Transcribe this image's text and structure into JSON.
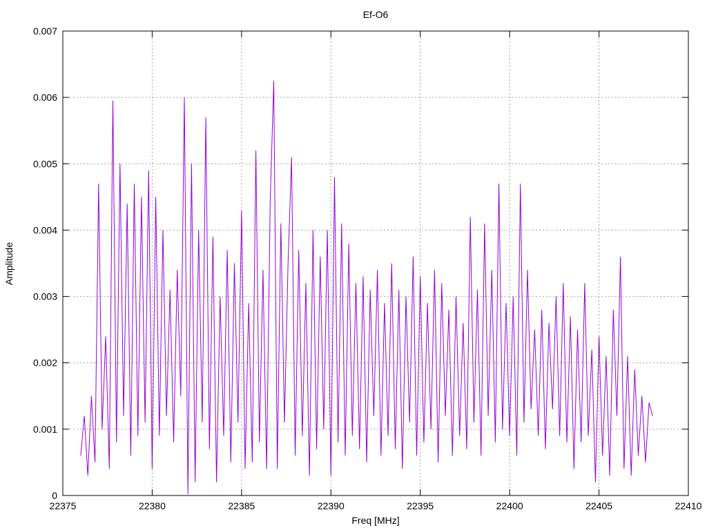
{
  "chart_data": {
    "type": "line",
    "title": "Ef-O6",
    "xlabel": "Freq [MHz]",
    "ylabel": "Amplitude",
    "xlim": [
      22375,
      22410
    ],
    "ylim": [
      0,
      0.007
    ],
    "xticks": [
      "22375",
      "22380",
      "22385",
      "22390",
      "22395",
      "22400",
      "22405",
      "22410"
    ],
    "xtick_values": [
      22375,
      22380,
      22385,
      22390,
      22395,
      22400,
      22405,
      22410
    ],
    "yticks": [
      "0",
      "0.001",
      "0.002",
      "0.003",
      "0.004",
      "0.005",
      "0.006",
      "0.007"
    ],
    "ytick_values": [
      0,
      0.001,
      0.002,
      0.003,
      0.004,
      0.005,
      0.006,
      0.007
    ],
    "grid": true,
    "legend": "none",
    "series": [
      {
        "name": "Ef-O6",
        "color": "#9400d3",
        "x_start": 22376.0,
        "x_step": 0.2,
        "values": [
          0.0006,
          0.0012,
          0.0003,
          0.0015,
          0.0005,
          0.0047,
          0.001,
          0.0024,
          0.0004,
          0.00595,
          0.0008,
          0.005,
          0.0012,
          0.0044,
          0.0006,
          0.0047,
          0.0009,
          0.0045,
          0.0011,
          0.0049,
          0.0004,
          0.0045,
          0.0009,
          0.004,
          0.0012,
          0.0031,
          0.0008,
          0.0034,
          0.0015,
          0.006,
          2e-05,
          0.005,
          0.0002,
          0.004,
          0.0011,
          0.0057,
          0.0007,
          0.0039,
          0.0002,
          0.003,
          0.0009,
          0.0037,
          0.0005,
          0.0035,
          0.0011,
          0.0043,
          0.0004,
          0.0029,
          0.0005,
          0.0052,
          0.0008,
          0.0034,
          0.0004,
          0.0044,
          0.00625,
          0.0004,
          0.0041,
          0.0011,
          0.0035,
          0.0051,
          0.0006,
          0.0037,
          0.0009,
          0.0032,
          0.0003,
          0.004,
          0.0007,
          0.0036,
          0.001,
          0.004,
          0.0003,
          0.0048,
          0.0008,
          0.0041,
          0.0006,
          0.0038,
          0.0009,
          0.0032,
          0.0007,
          0.0033,
          0.0005,
          0.0031,
          0.0012,
          0.0034,
          0.0006,
          0.0029,
          0.0009,
          0.0035,
          0.0007,
          0.0031,
          0.0004,
          0.003,
          0.0011,
          0.0036,
          0.0006,
          0.0033,
          0.0008,
          0.0029,
          0.001,
          0.0034,
          0.0005,
          0.0032,
          0.0012,
          0.0028,
          0.0006,
          0.003,
          0.0009,
          0.0026,
          0.0007,
          0.0042,
          0.0011,
          0.0031,
          0.0006,
          0.0041,
          0.0012,
          0.0034,
          0.0008,
          0.0047,
          0.001,
          0.0029,
          0.0009,
          0.003,
          0.0006,
          0.0047,
          0.0011,
          0.0034,
          0.0013,
          0.0025,
          0.0009,
          0.0028,
          0.0007,
          0.0026,
          0.0013,
          0.003,
          0.0009,
          0.0032,
          0.0008,
          0.0027,
          0.0004,
          0.0025,
          0.0008,
          0.0032,
          0.0009,
          0.0022,
          0.0002,
          0.0024,
          0.0006,
          0.0021,
          0.0003,
          0.0028,
          0.0012,
          0.0036,
          0.0004,
          0.0021,
          0.0003,
          0.0019,
          0.0006,
          0.0015,
          0.0005,
          0.0014,
          0.0012
        ]
      }
    ]
  }
}
